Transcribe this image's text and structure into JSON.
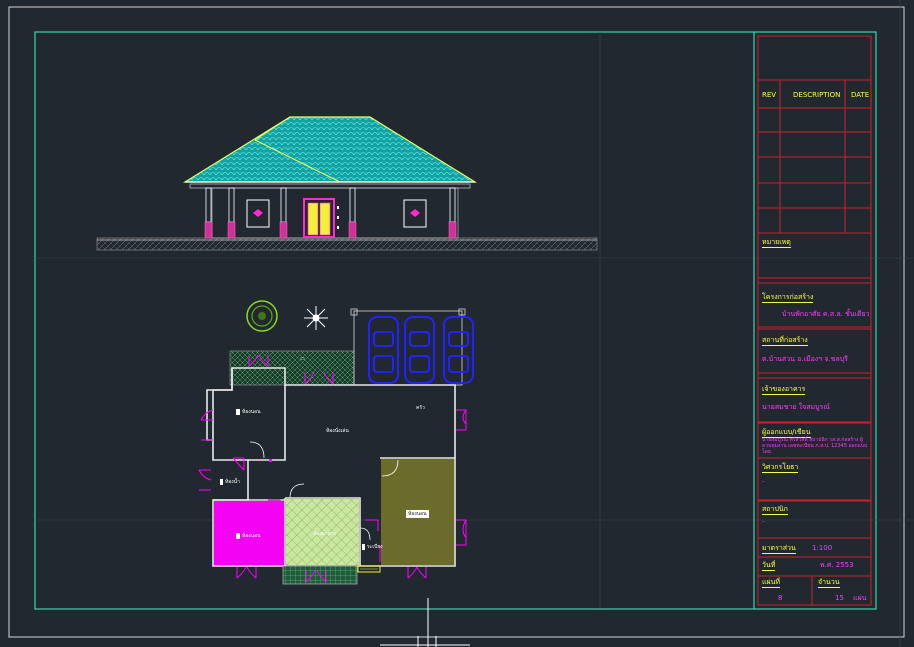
{
  "title_block": {
    "rev_table": {
      "headers": [
        "REV",
        "DESCRIPTION",
        "DATE"
      ]
    },
    "remarks_label": "หมายเหตุ",
    "project": {
      "label": "โครงการก่อสร้าง",
      "value": "บ้านพักอาศัย ค.ส.ล. ชั้นเดียว"
    },
    "location": {
      "label": "สถานที่ก่อสร้าง",
      "value": "ต.บ้านสวน อ.เมืองฯ จ.ชลบุรี"
    },
    "owner": {
      "label": "เจ้าของอาคาร",
      "value": "นายสมชาย ใจสมบูรณ์"
    },
    "designer": {
      "label": "ผู้ออกแบบ/เขียน",
      "value": "นายสมบูรณ์ ศรีสวัสดิ์ สถาปนิก วส.ส.ก่อสร้าง ผู้ควบคุมงาน เลขทะเบียน ภ.ส.ป. 12345 ออกแบบโดย"
    },
    "engineer": {
      "label": "วิศวกรโยธา",
      "value": "-"
    },
    "architect": {
      "label": "สถาปนิก",
      "value": "-"
    },
    "scale": {
      "label": "มาตราส่วน",
      "value": "1:100"
    },
    "date": {
      "label": "วันที่",
      "value": "พ.ศ. 2553"
    },
    "sheet_no": {
      "label": "แผ่นที่",
      "value": "8"
    },
    "sheet_total": {
      "label": "จำนวน",
      "value": "15",
      "unit": "แผ่น"
    }
  },
  "plan_labels": {
    "bedroom1": "ห้องนอน",
    "living": "ห้องนั่งเล่น",
    "kitchen": "ครัว",
    "bath": "ห้องน้ำ",
    "bedroom2": "ห้องนอน",
    "dining": "ห้องอาหาร",
    "bedroom3": "ห้องนอน",
    "terrace": "ระเบียง"
  },
  "colors": {
    "background": "#212830",
    "border_cyan": "#33d9b2",
    "title_block_red": "#cc1f2a",
    "roof_cyan": "#1fb5b5",
    "car_blue": "#2222ff",
    "magenta": "#ff00ff",
    "olive": "#6b6b2a",
    "light_green": "#c8e8a0"
  }
}
